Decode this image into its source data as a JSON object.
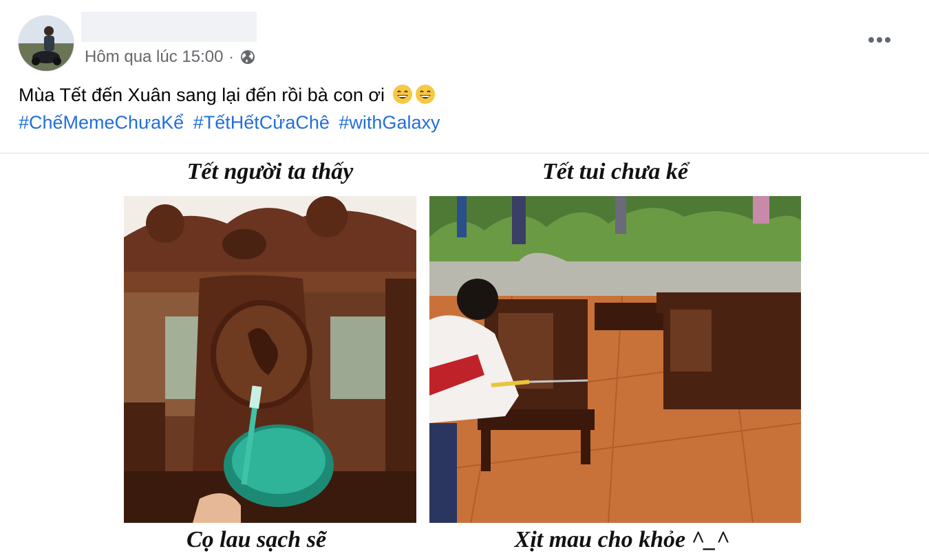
{
  "post": {
    "timestamp": "Hôm qua lúc 15:00",
    "separator": "·",
    "privacy_icon": "globe-icon",
    "more_icon": "more-horizontal-icon",
    "text": "Mùa Tết đến Xuân sang lại đến rồi bà con ơi",
    "emojis": [
      "grinning-face-icon",
      "grinning-face-icon"
    ],
    "hashtags": [
      "#ChếMemeChưaKể",
      "#TếtHếtCửaChê",
      "#withGalaxy"
    ]
  },
  "meme": {
    "left_title": "Tết người ta thấy",
    "right_title": "Tết tui chưa kể",
    "left_caption": "Cọ lau sạch sẽ",
    "right_caption": "Xịt mau cho khỏe ^_^"
  },
  "colors": {
    "hashtag": "#216fdb",
    "secondary_text": "#65676b",
    "wood": "#5a2a16",
    "floor": "#c9753a"
  }
}
